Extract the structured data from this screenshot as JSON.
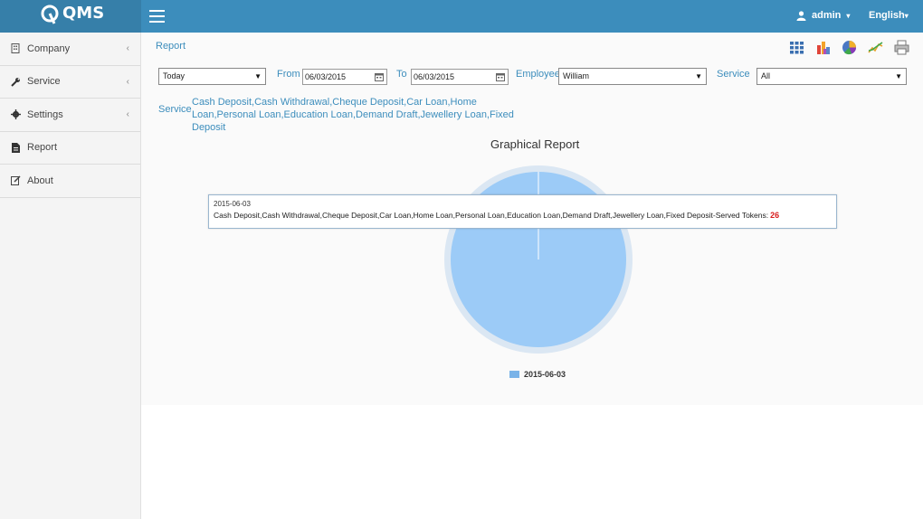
{
  "app": {
    "logo_text": "QMS"
  },
  "header": {
    "user_label": "admin",
    "language_label": "English"
  },
  "sidebar": {
    "items": [
      {
        "label": "Company",
        "icon": "building-icon",
        "has_chevron": true
      },
      {
        "label": "Service",
        "icon": "wrench-icon",
        "has_chevron": true
      },
      {
        "label": "Settings",
        "icon": "gear-icon",
        "has_chevron": true
      },
      {
        "label": "Report",
        "icon": "document-icon",
        "has_chevron": false
      },
      {
        "label": "About",
        "icon": "edit-icon",
        "has_chevron": false
      }
    ]
  },
  "page": {
    "title": "Report"
  },
  "toolbar": {
    "icons": [
      "table-icon",
      "bar-chart-icon",
      "pie-chart-icon",
      "line-chart-icon",
      "print-icon"
    ]
  },
  "filters": {
    "period": "Today",
    "from_label": "From",
    "from_value": "06/03/2015",
    "to_label": "To",
    "to_value": "06/03/2015",
    "employee_label": "Employee",
    "employee_value": "William",
    "service_label": "Service",
    "service_value": "All"
  },
  "service_summary": {
    "label": "Service",
    "text": "Cash Deposit,Cash Withdrawal,Cheque Deposit,Car Loan,Home Loan,Personal Loan,Education Loan,Demand Draft,Jewellery Loan,Fixed Deposit"
  },
  "chart_data": {
    "type": "pie",
    "title": "Graphical Report",
    "categories": [
      "2015-06-03"
    ],
    "values": [
      26
    ],
    "colors": [
      "#9ccbf7"
    ],
    "legend": "bottom",
    "tooltip": {
      "date": "2015-06-03",
      "text": "Cash Deposit,Cash Withdrawal,Cheque Deposit,Car Loan,Home Loan,Personal Loan,Education Loan,Demand Draft,Jewellery Loan,Fixed Deposit-Served Tokens:",
      "value": "26"
    }
  }
}
